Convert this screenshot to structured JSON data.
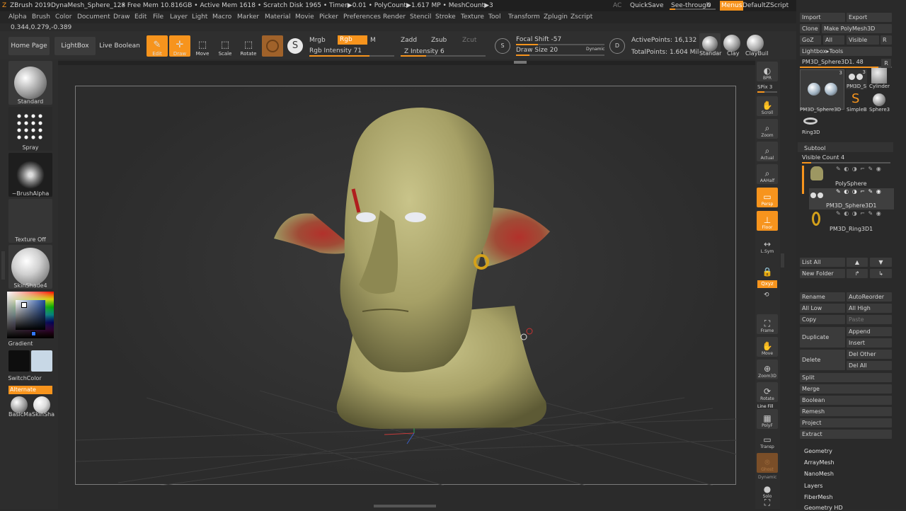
{
  "titlebar": {
    "app": "ZBrush 2019",
    "doc": "DynaMesh_Sphere_128",
    "stats": "..• Free Mem 10.816GB • Active Mem 1618 • Scratch Disk 1965 •  Timer▶0.01 • PolyCount▶1.617 MP • MeshCount▶3",
    "ac": "AC",
    "quicksave": "QuickSave",
    "seethrough": "See-through",
    "seethrough_value": "0",
    "menus": "Menus",
    "script": "DefaultZScript"
  },
  "menubar": [
    "Alpha",
    "Brush",
    "Color",
    "Document",
    "Draw",
    "Edit",
    "File",
    "Layer",
    "Light",
    "Macro",
    "Marker",
    "Material",
    "Movie",
    "Picker",
    "Preferences",
    "Render",
    "Stencil",
    "Stroke",
    "Texture",
    "Tool",
    "Transform",
    "Zplugin",
    "Zscript"
  ],
  "coords": "0.344,0.279,-0.389",
  "shelf": {
    "home": "Home Page",
    "lightbox": "LightBox",
    "liveboolean": "Live Boolean",
    "edit": "Edit",
    "draw": "Draw",
    "move": "Move",
    "scale": "Scale",
    "rotate": "Rotate",
    "mrgb": "Mrgb",
    "rgb": "Rgb",
    "m": "M",
    "rgb_intensity": "Rgb Intensity 71",
    "rgb_intensity_value": 71,
    "zadd": "Zadd",
    "zsub": "Zsub",
    "zcut": "Zcut",
    "z_intensity": "Z Intensity 6",
    "focal_shift": "Focal Shift -57",
    "draw_size": "Draw Size 20",
    "dynamic": "Dynamic",
    "active_points": "ActivePoints: 16,132",
    "total_points": "TotalPoints: 1.604 Mil",
    "brush1": "Standar",
    "brush2": "Clay",
    "brush3": "ClayBuil"
  },
  "left": {
    "standard": "Standard",
    "spray": "Spray",
    "alpha": "~BrushAlpha",
    "texture": "Texture Off",
    "material": "SkinShade4",
    "gradient": "Gradient",
    "switchcolor": "SwitchColor",
    "alternate": "Alternate",
    "mat1": "BasicMa",
    "mat2": "SkinSha"
  },
  "right_shelf": [
    "BPR",
    "SPix 3",
    "Scroll",
    "Zoom",
    "Actual",
    "AAHalf",
    "Persp",
    "Floor",
    "L.Sym",
    "",
    "Qxyz",
    "",
    "Frame",
    "Move",
    "Zoom3D",
    "Rotate",
    "Line Fill",
    "PolyF",
    "Transp",
    "Ghost",
    "Dynamic",
    "Solo"
  ],
  "panel": {
    "import": "Import",
    "export": "Export",
    "clone": "Clone",
    "make_polymesh": "Make PolyMesh3D",
    "goz": "GoZ",
    "all": "All",
    "visible": "Visible",
    "r": "R",
    "lightbox_tools": "Lightbox▸Tools",
    "current_tool": "PM3D_Sphere3D1. 48",
    "tools": [
      "PM3D_Sphere3D",
      "PM3D_S",
      "Cylinder",
      "SimpleB",
      "Sphere3",
      "Ring3D"
    ],
    "tool_count": "3",
    "subtool_header": "Subtool",
    "visible_count": "Visible Count 4",
    "subtools": [
      "PolySphere",
      "PM3D_Sphere3D1",
      "PM3D_Ring3D1"
    ],
    "list_all": "List All",
    "new_folder": "New Folder",
    "rename": "Rename",
    "autoreorder": "AutoReorder",
    "all_low": "All Low",
    "all_high": "All High",
    "copy": "Copy",
    "paste": "Paste",
    "duplicate": "Duplicate",
    "append": "Append",
    "insert": "Insert",
    "delete": "Delete",
    "del_other": "Del Other",
    "del_all": "Del All",
    "sections": [
      "Split",
      "Merge",
      "Boolean",
      "Remesh",
      "Project",
      "Extract"
    ],
    "subpalettes": [
      "Geometry",
      "ArrayMesh",
      "NanoMesh",
      "Layers",
      "FiberMesh",
      "Geometry HD"
    ]
  },
  "colors": {
    "accent": "#f7941d",
    "main_color": "#1a1a1a",
    "secondary_color": "#c8d8e6"
  }
}
